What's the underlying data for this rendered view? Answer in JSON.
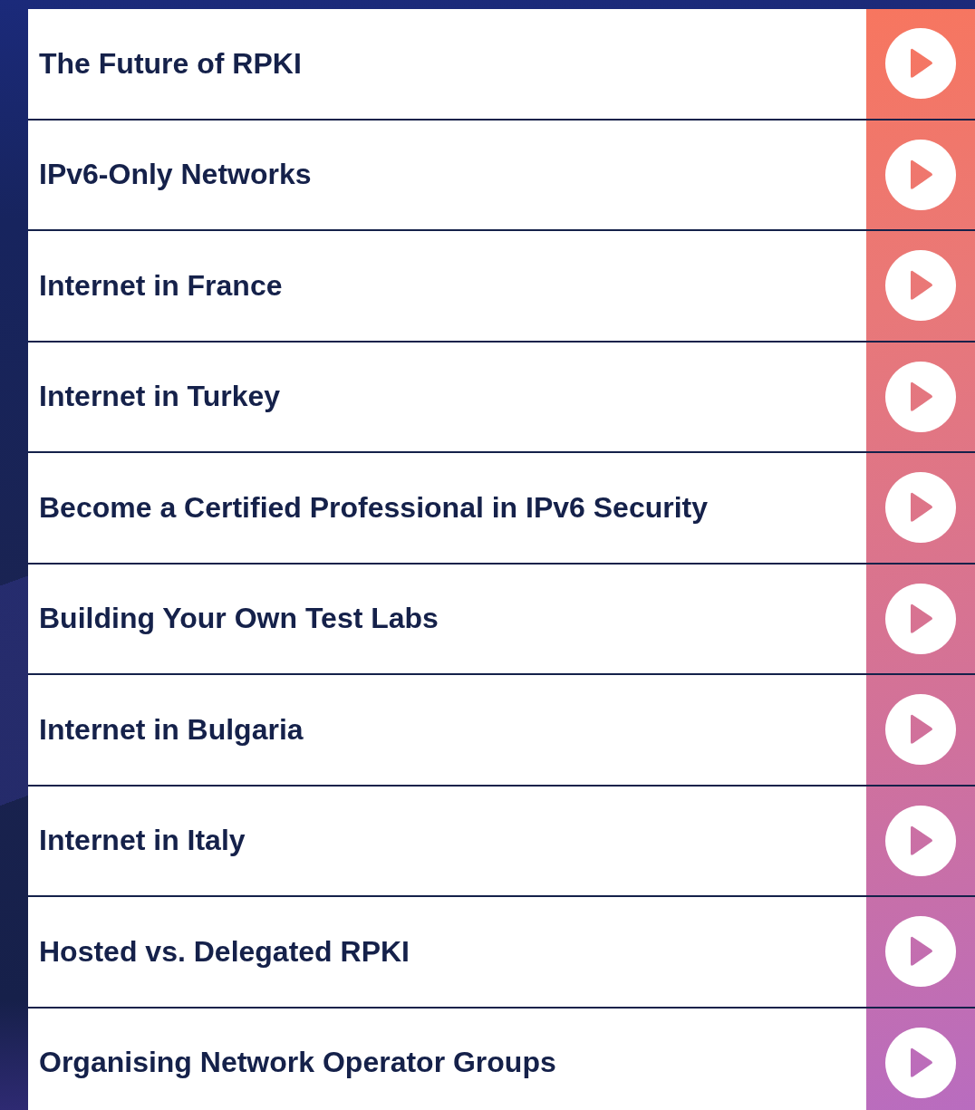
{
  "sessions": [
    {
      "title": "The Future of RPKI"
    },
    {
      "title": "IPv6-Only Networks"
    },
    {
      "title": "Internet in France"
    },
    {
      "title": "Internet in Turkey"
    },
    {
      "title": "Become a Certified Professional in IPv6 Security"
    },
    {
      "title": "Building Your Own Test Labs"
    },
    {
      "title": "Internet in Bulgaria"
    },
    {
      "title": "Internet in Italy"
    },
    {
      "title": "Hosted vs. Delegated RPKI"
    },
    {
      "title": "Organising Network Operator Groups"
    }
  ]
}
